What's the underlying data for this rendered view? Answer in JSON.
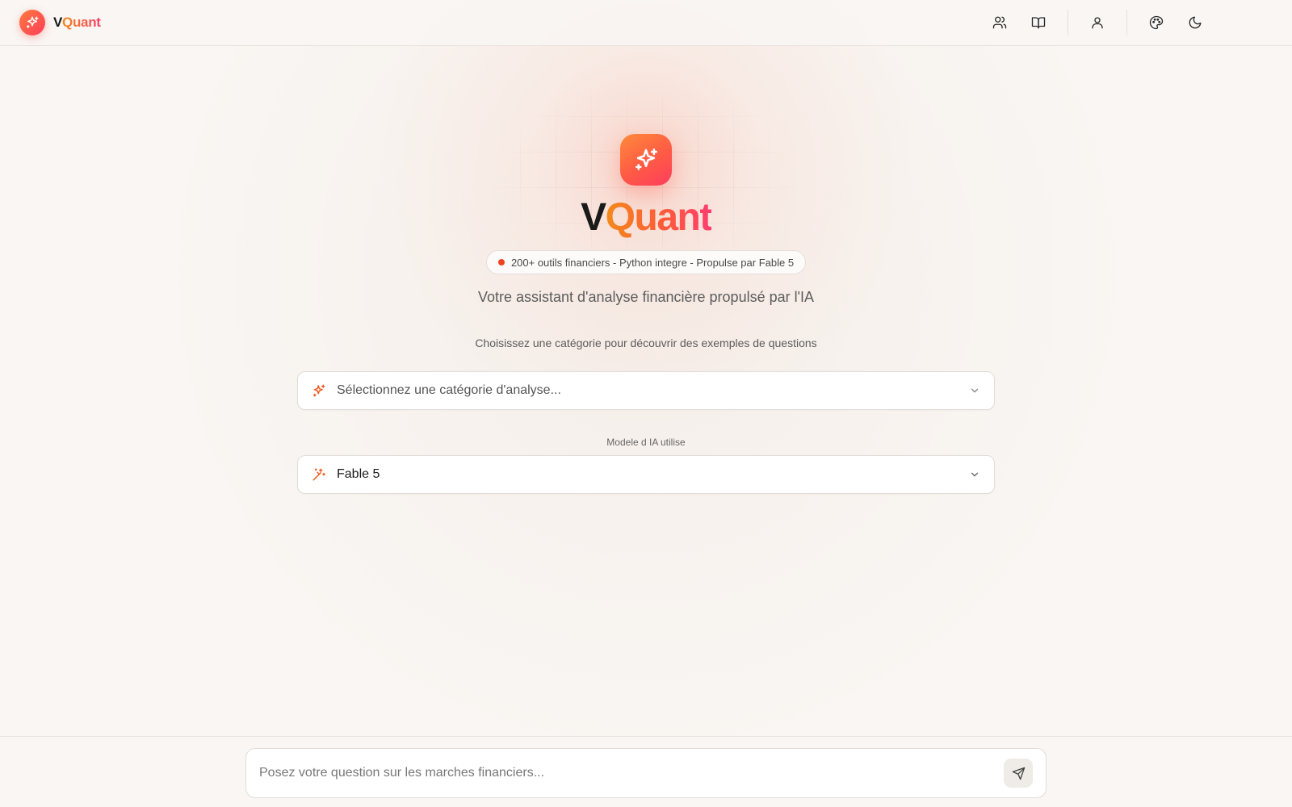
{
  "app": {
    "brand_prefix": "V",
    "brand_suffix": "Quant"
  },
  "header": {
    "nav_icons": [
      "users-icon",
      "book-open-icon",
      "user-icon",
      "palette-icon",
      "moon-icon"
    ]
  },
  "hero": {
    "title_prefix": "V",
    "title_suffix": "Quant",
    "badge": "200+ outils financiers - Python integre - Propulse par Fable 5",
    "subtitle": "Votre assistant d'analyse financière propulsé par l'IA",
    "hint": "Choisissez une catégorie pour découvrir des exemples de questions"
  },
  "category_select": {
    "placeholder": "Sélectionnez une catégorie d'analyse...",
    "icon": "sparkles-icon"
  },
  "model_select": {
    "label": "Modele d IA utilise",
    "value": "Fable 5",
    "icon": "wand-sparkles-icon"
  },
  "chat": {
    "placeholder": "Posez votre question sur les marches financiers...",
    "send_icon": "send-icon"
  },
  "colors": {
    "accent_orange": "#ff7a3d",
    "accent_pink": "#ff3d5e",
    "badge_dot": "#f0421e",
    "background": "#f9f6f3"
  }
}
